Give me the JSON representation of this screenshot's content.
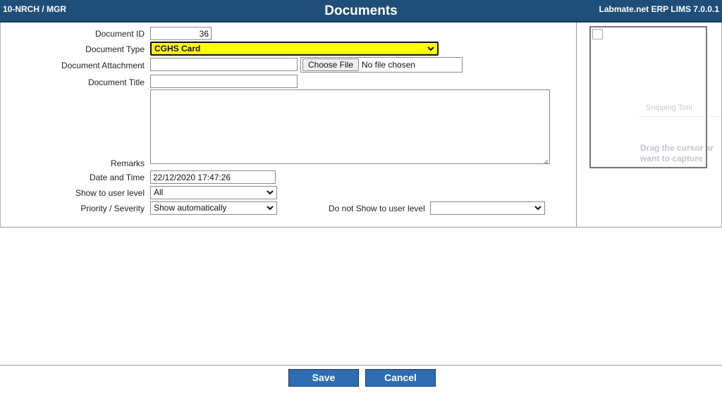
{
  "header": {
    "left": "10-NRCH / MGR",
    "title": "Documents",
    "right": "Labmate.net ERP LIMS 7.0.0.1"
  },
  "form": {
    "document_id_label": "Document ID",
    "document_id_value": "36",
    "document_type_label": "Document Type",
    "document_type_value": "CGHS Card",
    "attachment_label": "Document Attachment",
    "attachment_value": "",
    "choose_file_label": "Choose File",
    "no_file_text": "No file chosen",
    "title_label": "Document Title",
    "title_value": "",
    "remarks_label": "Remarks",
    "remarks_value": "",
    "datetime_label": "Date and Time",
    "datetime_value": "22/12/2020 17:47:26",
    "show_level_label": "Show to user level",
    "show_level_value": "All",
    "priority_label": "Priority / Severity",
    "priority_value": "Show automatically",
    "not_show_label": "Do not Show to user level",
    "not_show_value": ""
  },
  "overlay": {
    "title": "Snipping Tool",
    "body_line1": "Drag the cursor ar",
    "body_line2": "want to capture"
  },
  "actions": {
    "save_label": "Save",
    "cancel_label": "Cancel"
  },
  "colors": {
    "header_bg": "#1f4e79",
    "button_bg": "#2e6db4",
    "highlight": "#ffff00"
  }
}
